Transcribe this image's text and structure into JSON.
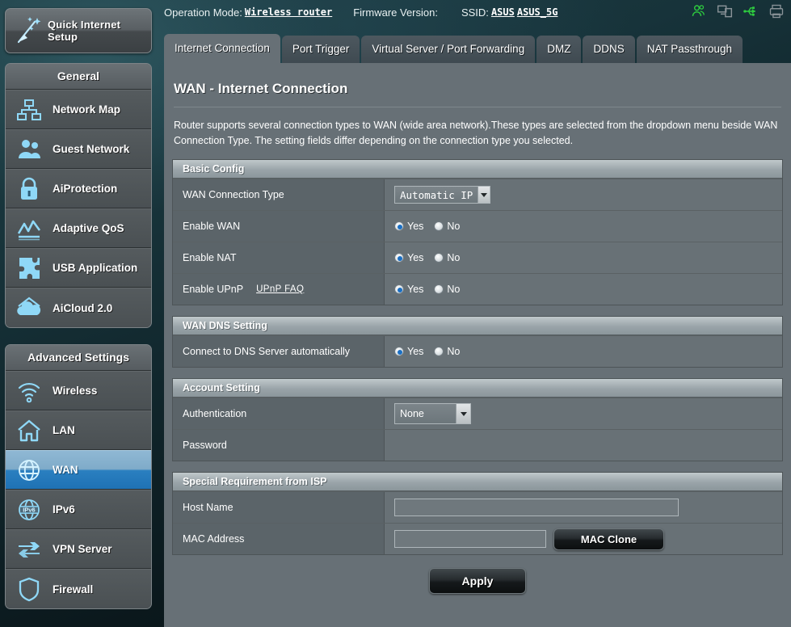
{
  "header": {
    "operation_mode_label": "Operation Mode:",
    "operation_mode_value": "Wireless router",
    "firmware_label": "Firmware Version:",
    "firmware_value": "",
    "ssid_label": "SSID:",
    "ssid_1": "ASUS",
    "ssid_2": "ASUS_5G",
    "icons": [
      {
        "name": "clients-icon",
        "color": "#2ecc3f"
      },
      {
        "name": "devices-icon",
        "color": "#8a9398"
      },
      {
        "name": "usb-icon",
        "color": "#2ecc3f"
      },
      {
        "name": "printer-icon",
        "color": "#8a9398"
      }
    ]
  },
  "quick_setup": {
    "label": "Quick Internet Setup",
    "icon": "magic-wand-icon"
  },
  "sidebar": {
    "groups": [
      {
        "title": "General",
        "items": [
          {
            "label": "Network Map",
            "icon": "network-map-icon",
            "active": false
          },
          {
            "label": "Guest Network",
            "icon": "guest-network-icon",
            "active": false
          },
          {
            "label": "AiProtection",
            "icon": "lock-icon",
            "active": false
          },
          {
            "label": "Adaptive QoS",
            "icon": "qos-chart-icon",
            "active": false
          },
          {
            "label": "USB Application",
            "icon": "puzzle-icon",
            "active": false
          },
          {
            "label": "AiCloud 2.0",
            "icon": "cloud-home-icon",
            "active": false
          }
        ]
      },
      {
        "title": "Advanced Settings",
        "items": [
          {
            "label": "Wireless",
            "icon": "wifi-icon",
            "active": false
          },
          {
            "label": "LAN",
            "icon": "home-icon",
            "active": false
          },
          {
            "label": "WAN",
            "icon": "globe-icon",
            "active": true
          },
          {
            "label": "IPv6",
            "icon": "ipv6-icon",
            "active": false
          },
          {
            "label": "VPN Server",
            "icon": "vpn-icon",
            "active": false
          },
          {
            "label": "Firewall",
            "icon": "shield-icon",
            "active": false
          }
        ]
      }
    ]
  },
  "tabs": [
    {
      "label": "Internet Connection",
      "active": true
    },
    {
      "label": "Port Trigger",
      "active": false
    },
    {
      "label": "Virtual Server / Port Forwarding",
      "active": false
    },
    {
      "label": "DMZ",
      "active": false
    },
    {
      "label": "DDNS",
      "active": false
    },
    {
      "label": "NAT Passthrough",
      "active": false
    }
  ],
  "page": {
    "title": "WAN - Internet Connection",
    "description": "Router supports several connection types to WAN (wide area network).These types are selected from the dropdown menu beside WAN Connection Type. The setting fields differ depending on the connection type you selected."
  },
  "sections": {
    "basic_config": {
      "title": "Basic Config",
      "wan_connection_type_label": "WAN Connection Type",
      "wan_connection_type_value": "Automatic IP",
      "enable_wan_label": "Enable WAN",
      "enable_wan_value": "Yes",
      "enable_nat_label": "Enable NAT",
      "enable_nat_value": "Yes",
      "enable_upnp_label": "Enable UPnP",
      "enable_upnp_faq_link": "UPnP FAQ",
      "enable_upnp_value": "Yes"
    },
    "wan_dns": {
      "title": "WAN DNS Setting",
      "auto_dns_label": "Connect to DNS Server automatically",
      "auto_dns_value": "Yes"
    },
    "account": {
      "title": "Account Setting",
      "authentication_label": "Authentication",
      "authentication_value": "None",
      "password_label": "Password",
      "password_value": ""
    },
    "isp": {
      "title": "Special Requirement from ISP",
      "host_name_label": "Host Name",
      "host_name_value": "",
      "mac_address_label": "MAC Address",
      "mac_address_value": "",
      "mac_clone_button": "MAC Clone"
    }
  },
  "radio_options": {
    "yes": "Yes",
    "no": "No"
  },
  "apply_button": "Apply"
}
